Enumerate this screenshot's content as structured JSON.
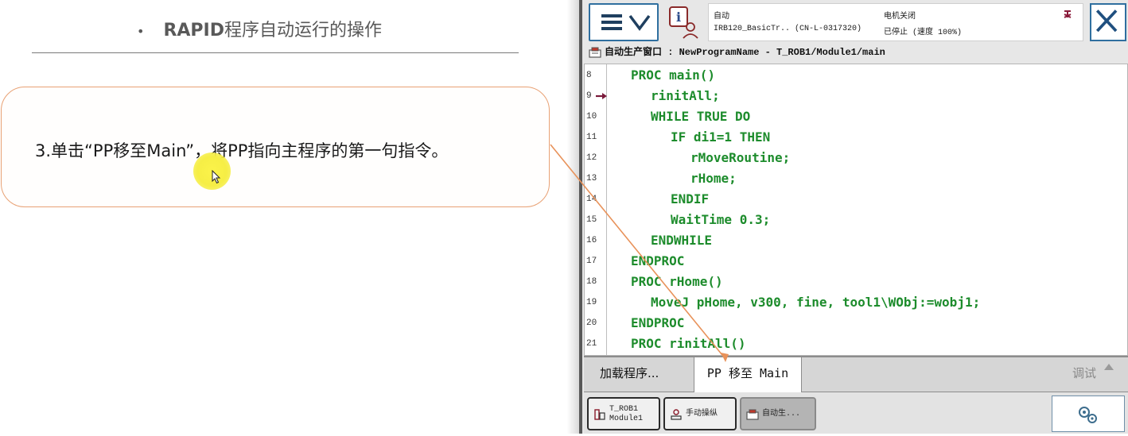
{
  "slide": {
    "title_bullet": "•",
    "title_bold": "RAPID",
    "title_rest": "程序自动运行的操作",
    "callout_text": "3.单击“PP移至Main”，将PP指向主程序的第一句指令。"
  },
  "pendant": {
    "status": {
      "mode": "自动",
      "station": "IRB120_BasicTr.. (CN-L-0317320)",
      "motors": "电机关闭",
      "state": "已停止 (速度 100%)"
    },
    "window_title": "自动生产窗口 : NewProgramName - T_ROB1/Module1/main",
    "code_lines": [
      {
        "num": "8",
        "text": "PROC main()",
        "indent": 0
      },
      {
        "num": "9",
        "text": "rinitAll;",
        "indent": 1
      },
      {
        "num": "10",
        "text": "WHILE TRUE DO",
        "indent": 1
      },
      {
        "num": "11",
        "text": "IF di1=1 THEN",
        "indent": 2
      },
      {
        "num": "12",
        "text": "rMoveRoutine;",
        "indent": 3
      },
      {
        "num": "13",
        "text": "rHome;",
        "indent": 3
      },
      {
        "num": "14",
        "text": "ENDIF",
        "indent": 2
      },
      {
        "num": "15",
        "text": "WaitTime 0.3;",
        "indent": 2
      },
      {
        "num": "16",
        "text": "ENDWHILE",
        "indent": 1
      },
      {
        "num": "17",
        "text": "ENDPROC",
        "indent": 0
      },
      {
        "num": "18",
        "text": "PROC rHome()",
        "indent": 0
      },
      {
        "num": "19",
        "text": "MoveJ pHome, v300, fine, tool1\\WObj:=wobj1;",
        "indent": 1
      },
      {
        "num": "20",
        "text": "ENDPROC",
        "indent": 0
      },
      {
        "num": "21",
        "text": "PROC rinitAll()",
        "indent": 0
      }
    ],
    "pp_line": "9",
    "commands": {
      "load": "加载程序...",
      "pp_to_main": "PP 移至 Main",
      "debug": "调试"
    },
    "tasks": [
      {
        "label": "T_ROB1\nModule1"
      },
      {
        "label": "手动操纵"
      },
      {
        "label": "自动生..."
      }
    ],
    "colors": {
      "code_green": "#1d8c2c",
      "callout_border": "#e8a174",
      "highlight_yellow": "#f6ee45",
      "pendant_blue": "#2f6f9f"
    }
  }
}
